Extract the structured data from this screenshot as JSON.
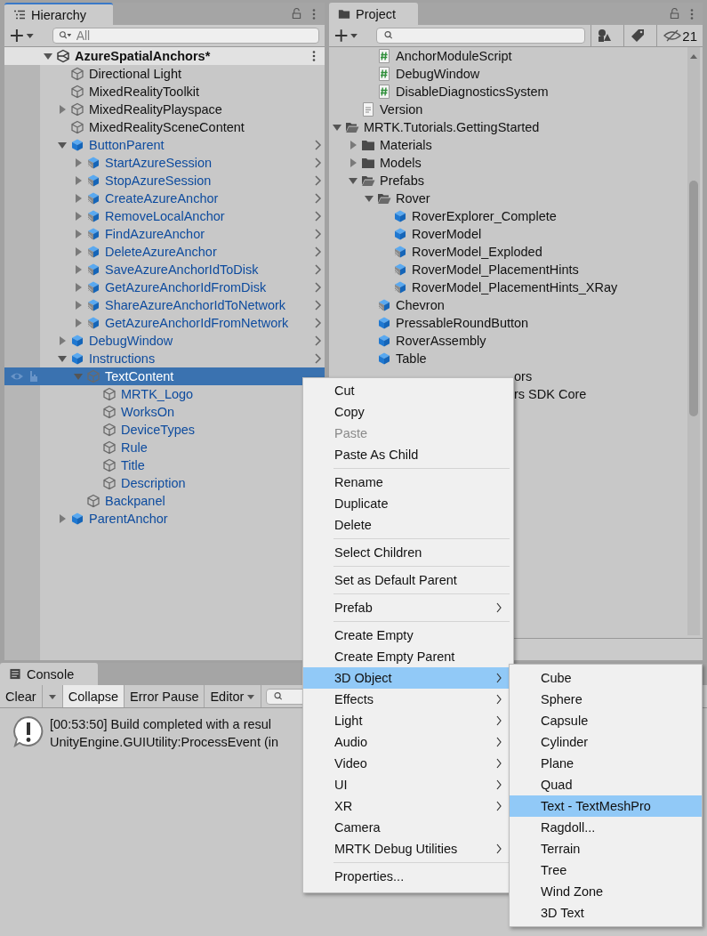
{
  "hierarchy": {
    "title": "Hierarchy",
    "search": {
      "placeholder": "All"
    },
    "scene": {
      "name": "AzureSpatialAnchors*",
      "expanded": true,
      "children": [
        {
          "name": "Directional Light",
          "kind": "object",
          "prefab": false,
          "chevron": false,
          "selected": false
        },
        {
          "name": "MixedRealityToolkit",
          "kind": "object",
          "prefab": false,
          "chevron": false,
          "selected": false
        },
        {
          "name": "MixedRealityPlayspace",
          "kind": "object",
          "prefab": false,
          "chevron": false,
          "selected": false,
          "expanded": false
        },
        {
          "name": "MixedRealitySceneContent",
          "kind": "object",
          "prefab": false,
          "chevron": false,
          "selected": false
        },
        {
          "name": "ButtonParent",
          "kind": "prefab",
          "prefab": true,
          "chevron": true,
          "selected": false,
          "expanded": true,
          "children": [
            {
              "name": "StartAzureSession",
              "kind": "variant",
              "prefab": true,
              "chevron": true,
              "selected": false,
              "expanded": false
            },
            {
              "name": "StopAzureSession",
              "kind": "variant",
              "prefab": true,
              "chevron": true,
              "selected": false,
              "expanded": false
            },
            {
              "name": "CreateAzureAnchor",
              "kind": "variant",
              "prefab": true,
              "chevron": true,
              "selected": false,
              "expanded": false
            },
            {
              "name": "RemoveLocalAnchor",
              "kind": "variant",
              "prefab": true,
              "chevron": true,
              "selected": false,
              "expanded": false
            },
            {
              "name": "FindAzureAnchor",
              "kind": "variant",
              "prefab": true,
              "chevron": true,
              "selected": false,
              "expanded": false
            },
            {
              "name": "DeleteAzureAnchor",
              "kind": "variant",
              "prefab": true,
              "chevron": true,
              "selected": false,
              "expanded": false
            },
            {
              "name": "SaveAzureAnchorIdToDisk",
              "kind": "variant",
              "prefab": true,
              "chevron": true,
              "selected": false,
              "expanded": false
            },
            {
              "name": "GetAzureAnchorIdFromDisk",
              "kind": "variant",
              "prefab": true,
              "chevron": true,
              "selected": false,
              "expanded": false
            },
            {
              "name": "ShareAzureAnchorIdToNetwork",
              "kind": "variant",
              "prefab": true,
              "chevron": true,
              "selected": false,
              "expanded": false
            },
            {
              "name": "GetAzureAnchorIdFromNetwork",
              "kind": "variant",
              "prefab": true,
              "chevron": true,
              "selected": false,
              "expanded": false
            }
          ]
        },
        {
          "name": "DebugWindow",
          "kind": "prefab",
          "prefab": true,
          "chevron": true,
          "selected": false,
          "expanded": false
        },
        {
          "name": "Instructions",
          "kind": "prefab",
          "prefab": true,
          "chevron": true,
          "selected": false,
          "expanded": true,
          "children": [
            {
              "name": "TextContent",
              "kind": "object",
              "prefab": true,
              "chevron": false,
              "selected": true,
              "expanded": true,
              "children": [
                {
                  "name": "MRTK_Logo",
                  "kind": "object",
                  "prefab": true,
                  "selected": false
                },
                {
                  "name": "WorksOn",
                  "kind": "object",
                  "prefab": true,
                  "selected": false
                },
                {
                  "name": "DeviceTypes",
                  "kind": "object",
                  "prefab": true,
                  "selected": false
                },
                {
                  "name": "Rule",
                  "kind": "object",
                  "prefab": true,
                  "selected": false
                },
                {
                  "name": "Title",
                  "kind": "object",
                  "prefab": true,
                  "selected": false
                },
                {
                  "name": "Description",
                  "kind": "object",
                  "prefab": true,
                  "selected": false
                }
              ]
            },
            {
              "name": "Backpanel",
              "kind": "object",
              "prefab": true,
              "selected": false
            }
          ]
        },
        {
          "name": "ParentAnchor",
          "kind": "prefab",
          "prefab": true,
          "selected": false,
          "expanded": false
        }
      ]
    }
  },
  "project": {
    "title": "Project",
    "hidden_count": "21",
    "tree": [
      {
        "children": [
          {
            "children": [
              {
                "name": "AnchorModuleScript",
                "kind": "script",
                "selected": false
              },
              {
                "name": "DebugWindow",
                "kind": "script",
                "selected": false
              },
              {
                "name": "DisableDiagnosticsSystem",
                "kind": "script",
                "selected": false
              }
            ]
          },
          {
            "name": "Version",
            "kind": "text",
            "selected": false
          }
        ]
      },
      {
        "name": "MRTK.Tutorials.GettingStarted",
        "kind": "folder",
        "selected": false,
        "expanded": true,
        "children": [
          {
            "name": "Materials",
            "kind": "folder",
            "selected": false,
            "expanded": false
          },
          {
            "name": "Models",
            "kind": "folder",
            "selected": false,
            "expanded": false
          },
          {
            "name": "Prefabs",
            "kind": "folder",
            "selected": false,
            "expanded": true,
            "children": [
              {
                "name": "Rover",
                "kind": "folder",
                "selected": false,
                "expanded": true,
                "children": [
                  {
                    "name": "RoverExplorer_Complete",
                    "kind": "prefab",
                    "selected": false
                  },
                  {
                    "name": "RoverModel",
                    "kind": "prefab",
                    "selected": false
                  },
                  {
                    "name": "RoverModel_Exploded",
                    "kind": "variant",
                    "selected": false
                  },
                  {
                    "name": "RoverModel_PlacementHints",
                    "kind": "variant",
                    "selected": false
                  },
                  {
                    "name": "RoverModel_PlacementHints_XRay",
                    "kind": "variant",
                    "selected": false
                  }
                ]
              },
              {
                "name": "Chevron",
                "kind": "variant",
                "selected": false
              },
              {
                "name": "PressableRoundButton",
                "kind": "prefab",
                "selected": false
              },
              {
                "name": "RoverAssembly",
                "kind": "prefab",
                "selected": false
              },
              {
                "name": "Table",
                "kind": "prefab",
                "selected": false
              }
            ]
          }
        ]
      }
    ],
    "covered_rows": [
      "ors",
      "rs SDK Core"
    ]
  },
  "console": {
    "title": "Console",
    "tools": [
      {
        "kind": "button",
        "label": "Clear"
      },
      {
        "kind": "arrow"
      },
      {
        "kind": "toggle",
        "label": "Collapse",
        "on": true
      },
      {
        "kind": "toggle",
        "label": "Error Pause",
        "on": false
      },
      {
        "kind": "dropdown",
        "label": "Editor"
      }
    ],
    "messages": [
      {
        "kind": "warning",
        "lines": [
          "[00:53:50] Build completed with a resul",
          "UnityEngine.GUIUtility:ProcessEvent (in"
        ]
      }
    ]
  },
  "context_menu": {
    "items": [
      {
        "kind": "item",
        "label": "Cut",
        "disabled": false,
        "selected": false,
        "submenu": false
      },
      {
        "kind": "item",
        "label": "Copy",
        "disabled": false,
        "selected": false,
        "submenu": false
      },
      {
        "kind": "item",
        "label": "Paste",
        "disabled": true,
        "selected": false,
        "submenu": false
      },
      {
        "kind": "item",
        "label": "Paste As Child",
        "disabled": false,
        "selected": false,
        "submenu": false
      },
      {
        "kind": "separator"
      },
      {
        "kind": "item",
        "label": "Rename",
        "disabled": false,
        "selected": false,
        "submenu": false
      },
      {
        "kind": "item",
        "label": "Duplicate",
        "disabled": false,
        "selected": false,
        "submenu": false
      },
      {
        "kind": "item",
        "label": "Delete",
        "disabled": false,
        "selected": false,
        "submenu": false
      },
      {
        "kind": "separator"
      },
      {
        "kind": "item",
        "label": "Select Children",
        "disabled": false,
        "selected": false,
        "submenu": false
      },
      {
        "kind": "separator"
      },
      {
        "kind": "item",
        "label": "Set as Default Parent",
        "disabled": false,
        "selected": false,
        "submenu": false
      },
      {
        "kind": "separator"
      },
      {
        "kind": "item",
        "label": "Prefab",
        "disabled": false,
        "selected": false,
        "submenu": true
      },
      {
        "kind": "separator"
      },
      {
        "kind": "item",
        "label": "Create Empty",
        "disabled": false,
        "selected": false,
        "submenu": false
      },
      {
        "kind": "item",
        "label": "Create Empty Parent",
        "disabled": false,
        "selected": false,
        "submenu": false
      },
      {
        "kind": "item",
        "label": "3D Object",
        "disabled": false,
        "selected": true,
        "submenu": true
      },
      {
        "kind": "item",
        "label": "Effects",
        "disabled": false,
        "selected": false,
        "submenu": true
      },
      {
        "kind": "item",
        "label": "Light",
        "disabled": false,
        "selected": false,
        "submenu": true
      },
      {
        "kind": "item",
        "label": "Audio",
        "disabled": false,
        "selected": false,
        "submenu": true
      },
      {
        "kind": "item",
        "label": "Video",
        "disabled": false,
        "selected": false,
        "submenu": true
      },
      {
        "kind": "item",
        "label": "UI",
        "disabled": false,
        "selected": false,
        "submenu": true
      },
      {
        "kind": "item",
        "label": "XR",
        "disabled": false,
        "selected": false,
        "submenu": true
      },
      {
        "kind": "item",
        "label": "Camera",
        "disabled": false,
        "selected": false,
        "submenu": false
      },
      {
        "kind": "item",
        "label": "MRTK Debug Utilities",
        "disabled": false,
        "selected": false,
        "submenu": true
      },
      {
        "kind": "separator"
      },
      {
        "kind": "item",
        "label": "Properties...",
        "disabled": false,
        "selected": false,
        "submenu": false
      }
    ],
    "submenu": [
      {
        "label": "Cube",
        "selected": false
      },
      {
        "label": "Sphere",
        "selected": false
      },
      {
        "label": "Capsule",
        "selected": false
      },
      {
        "label": "Cylinder",
        "selected": false
      },
      {
        "label": "Plane",
        "selected": false
      },
      {
        "label": "Quad",
        "selected": false
      },
      {
        "label": "Text - TextMeshPro",
        "selected": true
      },
      {
        "label": "Ragdoll...",
        "selected": false
      },
      {
        "label": "Terrain",
        "selected": false
      },
      {
        "label": "Tree",
        "selected": false
      },
      {
        "label": "Wind Zone",
        "selected": false
      },
      {
        "label": "3D Text",
        "selected": false
      }
    ]
  }
}
